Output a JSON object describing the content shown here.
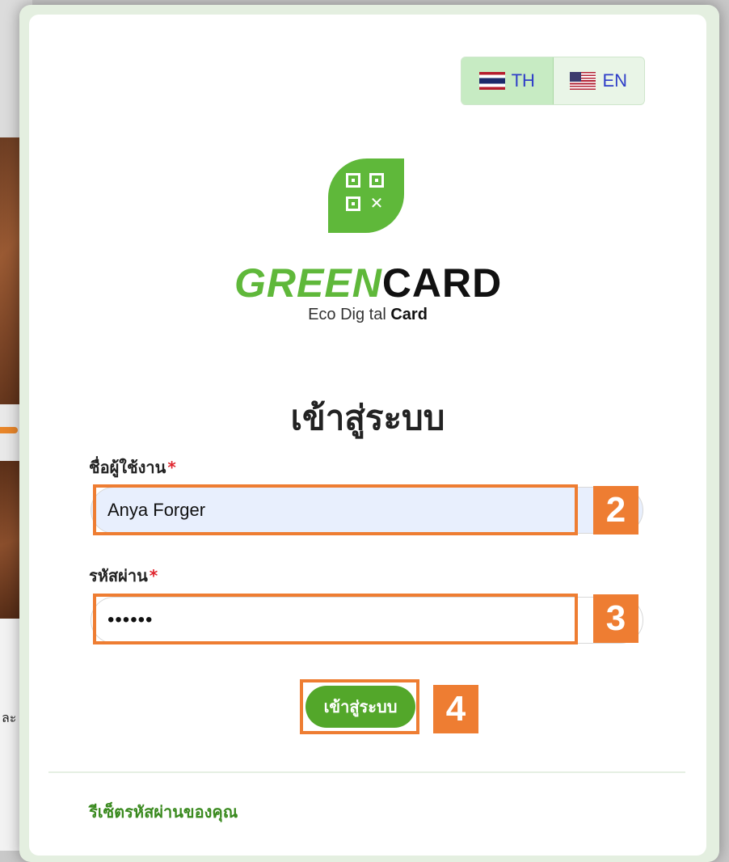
{
  "background": {
    "partial_text": "ละ"
  },
  "language_switch": {
    "th_label": "TH",
    "en_label": "EN",
    "active": "TH",
    "th_flag": "thailand-flag-icon",
    "en_flag": "us-flag-icon"
  },
  "logo": {
    "brand_part1": "GREEN",
    "brand_part2": "CARD",
    "tagline_part1": "Eco Dig tal ",
    "tagline_part2": "Card",
    "mark_icon": "qr-code-leaf-icon"
  },
  "form": {
    "title": "เข้าสู่ระบบ",
    "username_label": "ชื่อผู้ใช้งาน",
    "username_value": "Anya Forger",
    "password_label": "รหัสผ่าน",
    "password_value": "••••••",
    "required_mark": "*",
    "submit_label": "เข้าสู่ระบบ"
  },
  "annotations": {
    "step2": "2",
    "step3": "3",
    "step4": "4"
  },
  "footer": {
    "reset_password_link": "รีเซ็ตรหัสผ่านของคุณ"
  },
  "colors": {
    "brand_green": "#5fb83a",
    "button_green": "#53a72a",
    "annotation_orange": "#ee7d32",
    "link_green": "#3a8a1f",
    "required_red": "#e0262f"
  }
}
